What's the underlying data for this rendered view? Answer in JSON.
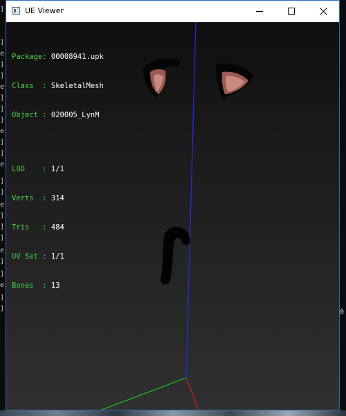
{
  "window": {
    "title": "UE Viewer",
    "buttons": {
      "minimize": "minimize",
      "maximize": "maximize",
      "close": "close"
    }
  },
  "info": {
    "group1": [
      {
        "key": "Package:",
        "value": "00008941.upk"
      },
      {
        "key": "Class  :",
        "value": "SkeletalMesh"
      },
      {
        "key": "Object :",
        "value": "020005_LynM"
      }
    ],
    "group2": [
      {
        "key": "LOD    :",
        "value": "1/1"
      },
      {
        "key": "Verts  :",
        "value": "314"
      },
      {
        "key": "Tris   :",
        "value": "484"
      },
      {
        "key": "UV Set :",
        "value": "1/1"
      },
      {
        "key": "Bones  :",
        "value": "13"
      }
    ]
  },
  "background_console": {
    "left_chars": [
      "]",
      "]",
      "e",
      "]",
      "]",
      "e",
      "]",
      "]",
      "]",
      "e",
      "]",
      "]",
      "e",
      "]",
      "]",
      "e",
      "]",
      "]",
      "]",
      "e",
      "]",
      "]",
      "e",
      "]",
      "]"
    ],
    "right_chars": [
      "0"
    ]
  },
  "colors": {
    "label_green": "#4fd44f",
    "value_white": "#ffffff",
    "axis_blue": "#1f2fd6",
    "axis_green": "#1ec81e",
    "axis_red": "#d21e1e",
    "titlebar": "#ffffff",
    "window_border": "#2e6fbf"
  }
}
